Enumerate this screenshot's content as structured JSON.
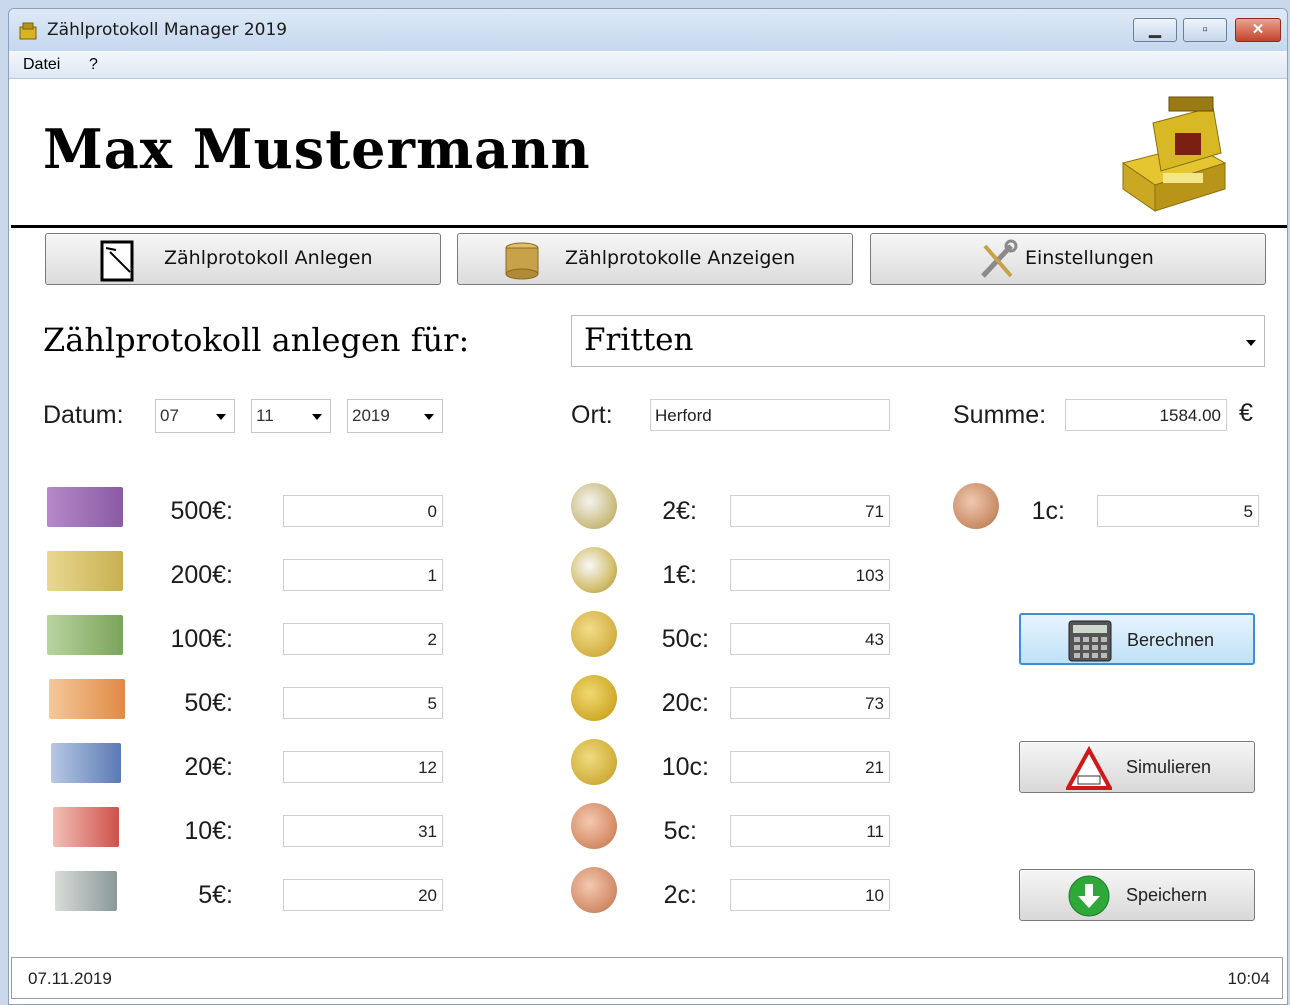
{
  "window": {
    "title": "Zählprotokoll Manager 2019"
  },
  "menu": {
    "file": "Datei",
    "help": "?"
  },
  "header": {
    "user_name": "Max Mustermann"
  },
  "nav": {
    "create_label": "Zählprotokoll Anlegen",
    "show_label": "Zählprotokolle Anzeigen",
    "settings_label": "Einstellungen"
  },
  "form": {
    "create_for_label": "Zählprotokoll anlegen für:",
    "target_value": "Fritten",
    "date_label": "Datum:",
    "day": "07",
    "month": "11",
    "year": "2019",
    "place_label": "Ort:",
    "place_value": "Herford",
    "sum_label": "Summe:",
    "sum_value": "1584.00",
    "currency": "€"
  },
  "notes": [
    {
      "label": "500€:",
      "value": "0"
    },
    {
      "label": "200€:",
      "value": "1"
    },
    {
      "label": "100€:",
      "value": "2"
    },
    {
      "label": "50€:",
      "value": "5"
    },
    {
      "label": "20€:",
      "value": "12"
    },
    {
      "label": "10€:",
      "value": "31"
    },
    {
      "label": "5€:",
      "value": "20"
    }
  ],
  "coins": [
    {
      "label": "2€:",
      "value": "71"
    },
    {
      "label": "1€:",
      "value": "103"
    },
    {
      "label": "50c:",
      "value": "43"
    },
    {
      "label": "20c:",
      "value": "73"
    },
    {
      "label": "10c:",
      "value": "21"
    },
    {
      "label": "5c:",
      "value": "11"
    },
    {
      "label": "2c:",
      "value": "10"
    },
    {
      "label": "1c:",
      "value": "5"
    }
  ],
  "actions": {
    "calculate_label": "Berechnen",
    "simulate_label": "Simulieren",
    "save_label": "Speichern"
  },
  "status": {
    "date": "07.11.2019",
    "time": "10:04"
  },
  "colors": {
    "accent_border": "#3c8fd6",
    "titlebar": "#c5d8ee",
    "close_button": "#c4432c"
  }
}
